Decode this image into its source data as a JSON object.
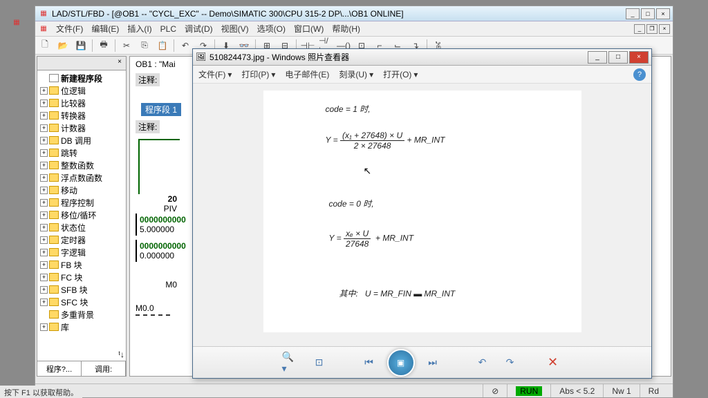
{
  "mainWindow": {
    "title": "LAD/STL/FBD  - [@OB1 -- \"CYCL_EXC\" --  Demo\\SIMATIC 300\\CPU 315-2 DP\\...\\OB1  ONLINE]"
  },
  "menus": [
    "文件(F)",
    "编辑(E)",
    "插入(I)",
    "PLC",
    "调试(D)",
    "视图(V)",
    "选项(O)",
    "窗口(W)",
    "帮助(H)"
  ],
  "tree": {
    "newSeg": "新建程序段",
    "items": [
      "位逻辑",
      "比较器",
      "转换器",
      "计数器",
      "DB 调用",
      "跳转",
      "整数函数",
      "浮点数函数",
      "移动",
      "程序控制",
      "移位/循环",
      "状态位",
      "定时器",
      "字逻辑",
      "FB 块",
      "FC 块",
      "SFB 块",
      "SFC 块",
      "多重背景",
      "库"
    ]
  },
  "leftTabs": {
    "left": "程序?...",
    "right": "调用:"
  },
  "editor": {
    "ob": "OB1 :  \"Mai",
    "comment": "注释:",
    "seg": "程序段  1",
    "piv": "PIV",
    "hdr": "20",
    "val1a": "0000000000",
    "val1b": "5.000000",
    "val2a": "0000000000",
    "val2b": "0.000000",
    "m0": "M0",
    "m00": "M0.0"
  },
  "photoViewer": {
    "title": "510824473.jpg - Windows 照片查看器",
    "menus": [
      "文件(F)",
      "打印(P)",
      "电子邮件(E)",
      "刻录(U)",
      "打开(O)"
    ]
  },
  "handwriting": {
    "l1": "code = 1 时,",
    "l2_pre": "Y =",
    "l2_num": "(x₁ + 27648) × U",
    "l2_den": "2 × 27648",
    "l2_post": "+ MR_INT",
    "l3": "code = 0 时,",
    "l4_pre": "Y =",
    "l4_num": "xₑ × U",
    "l4_den": "27648",
    "l4_post": "+ MR_INT",
    "l5_pre": "其中:",
    "l5_eq": "U = MR_FIN ▬ MR_INT"
  },
  "status": {
    "hint": "按下 F1 以获取帮助。",
    "abs": "Abs < 5.2",
    "nw": "Nw 1",
    "rd": "Rd",
    "run": "RUN"
  }
}
